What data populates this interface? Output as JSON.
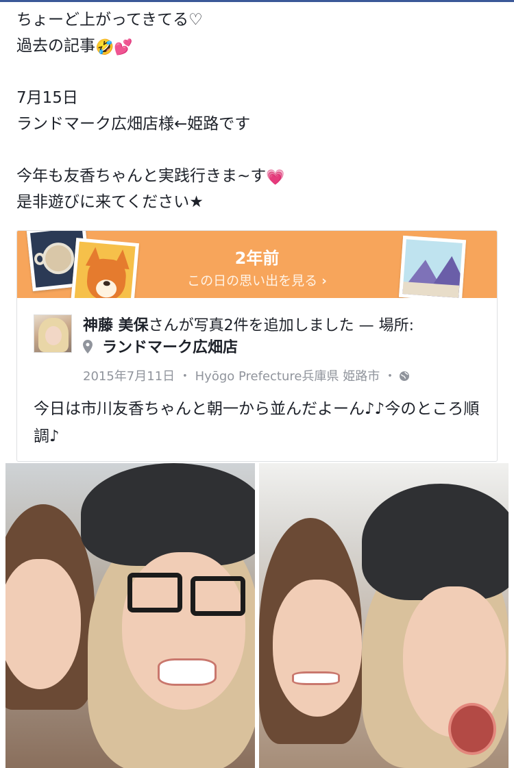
{
  "post": {
    "lines": [
      "ちょーど上がってきてる♡",
      "過去の記事",
      "",
      "7月15日",
      "ランドマーク広畑店様←姫路です",
      "",
      "今年も友香ちゃんと実践行きま~す",
      "是非遊びに来てください★"
    ],
    "emojis": {
      "laugh": "🤣",
      "hearts": "💕",
      "heart_grow": "💗"
    }
  },
  "memory": {
    "years_ago": "2年前",
    "see_memories": "この日の思い出を見る",
    "chevron": "›",
    "banner_color": "#f7a55b"
  },
  "shared_post": {
    "author": "神藤 美保",
    "action": "さんが写真2件を追加しました — 場所:",
    "place": "ランドマーク広畑店",
    "date": "2015年7月11日",
    "separator": "・",
    "location": "Hyōgo Prefecture兵庫県 姫路市",
    "caption": "今日は市川友香ちゃんと朝一から並んだよーん♪♪今のところ順調♪",
    "icons": [
      "location-pin-icon",
      "globe-icon"
    ]
  },
  "photos": [
    {
      "name": "photo-selfie-glasses"
    },
    {
      "name": "photo-selfie-tongue"
    }
  ]
}
